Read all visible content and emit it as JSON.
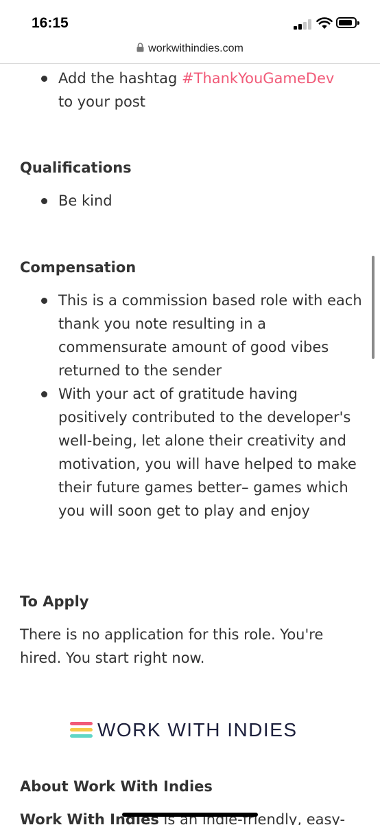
{
  "status": {
    "time": "16:15",
    "signal_bars": 2,
    "signal_total": 4
  },
  "browser": {
    "url": "workwithindies.com"
  },
  "top_item": {
    "text": "Add the hashtag ",
    "hashtag": "#ThankYouGameDev",
    "rest": "to your post"
  },
  "qualifications": {
    "heading": "Qualifications",
    "items": [
      "Be kind"
    ]
  },
  "compensation": {
    "heading": "Compensation",
    "items": [
      "This is a commission based role with each thank you note resulting in a commensurate amount of good vibes returned to the sender",
      "With your act of gratitude having positively contributed to the developer's well-being, let alone their creativity and motivation, you will have helped to make their future games better– games which you will soon get to play and enjoy"
    ]
  },
  "apply": {
    "heading": "To Apply",
    "text": "There is no application for this role. You're hired. You start right now."
  },
  "logo": {
    "text": "WORK WITH INDIES",
    "stripe_colors": [
      "#f15a78",
      "#f7c948",
      "#5fd6c6"
    ]
  },
  "about": {
    "heading": "About Work With Indies",
    "text_bold": "Work With Indies",
    "text_rest": " is an indie-friendly, easy-"
  },
  "colors": {
    "accent": "#f15a78",
    "text": "#333333",
    "logo_text": "#1c1f3b"
  }
}
